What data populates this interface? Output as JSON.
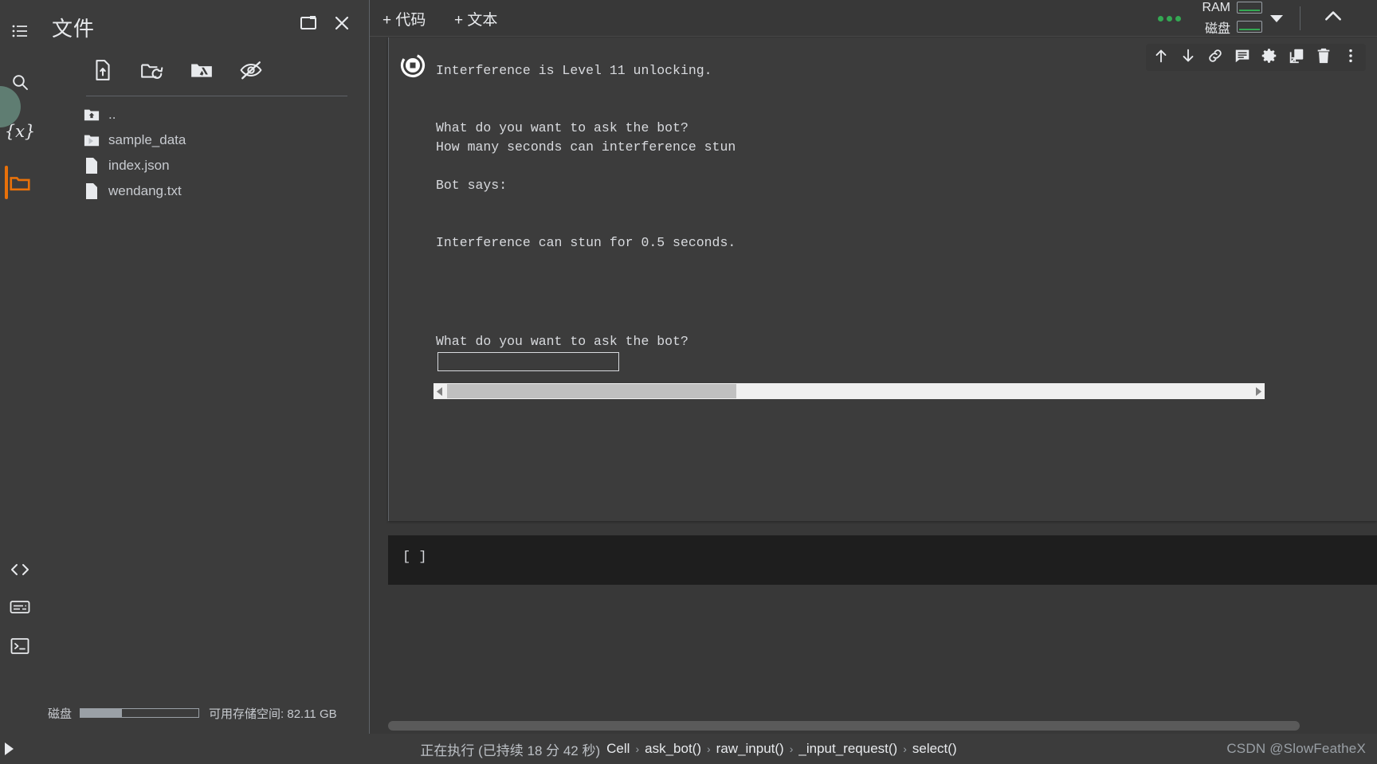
{
  "rail": {
    "items": [
      {
        "name": "table-of-contents",
        "icon": "list-icon"
      },
      {
        "name": "search",
        "icon": "search-icon"
      },
      {
        "name": "variables",
        "icon": "variables-icon"
      },
      {
        "name": "files",
        "icon": "folder-icon",
        "selected": true
      },
      {
        "name": "code-snippets",
        "icon": "code-brackets-icon"
      },
      {
        "name": "commands",
        "icon": "keyboard-icon"
      },
      {
        "name": "terminal",
        "icon": "terminal-icon"
      }
    ]
  },
  "files_panel": {
    "title": "文件",
    "header_buttons": [
      {
        "name": "open-in-new-pane",
        "icon": "window-icon"
      },
      {
        "name": "close-panel",
        "icon": "close-icon"
      }
    ],
    "toolbar": [
      {
        "name": "upload-file",
        "icon": "upload-file-icon"
      },
      {
        "name": "refresh-folder",
        "icon": "refresh-folder-icon"
      },
      {
        "name": "mount-drive",
        "icon": "google-drive-icon"
      },
      {
        "name": "toggle-hidden",
        "icon": "eye-off-icon"
      }
    ],
    "entries": [
      {
        "name": "..",
        "type": "parent"
      },
      {
        "name": "sample_data",
        "type": "folder",
        "expandable": true
      },
      {
        "name": "index.json",
        "type": "file"
      },
      {
        "name": "wendang.txt",
        "type": "file"
      }
    ],
    "footer": {
      "disk_label": "磁盘",
      "disk_used_percent": 35,
      "free_text": "可用存储空间: 82.11 GB"
    }
  },
  "notebook_toolbar": {
    "add_code": "+ 代码",
    "add_text": "+ 文本",
    "ram_label": "RAM",
    "disk_label": "磁盘",
    "status_color": "#34a853",
    "ram_gauge_percent": 20,
    "disk_gauge_percent": 20
  },
  "cell": {
    "run_state": "running",
    "actions": [
      {
        "name": "move-cell-up",
        "icon": "arrow-up-icon"
      },
      {
        "name": "move-cell-down",
        "icon": "arrow-down-icon"
      },
      {
        "name": "copy-cell-link",
        "icon": "link-icon"
      },
      {
        "name": "add-comment",
        "icon": "comment-icon"
      },
      {
        "name": "cell-settings",
        "icon": "gear-icon"
      },
      {
        "name": "mirror-cell",
        "icon": "mirror-cell-icon"
      },
      {
        "name": "delete-cell",
        "icon": "trash-icon"
      },
      {
        "name": "more-options",
        "icon": "more-vertical-icon"
      }
    ],
    "output_lines": [
      "Interference is Level 11 unlocking.",
      "",
      "",
      "What do you want to ask the bot?",
      "How many seconds can interference stun",
      "",
      "Bot says:",
      "",
      "",
      "Interference can stun for 0.5 seconds."
    ],
    "prompt_label": "What do you want to ask the bot?",
    "prompt_value": "",
    "prompt_placeholder": "",
    "output_scroll": {
      "thumb_percent": 36,
      "left_arrow": "scroll-left-arrow",
      "right_arrow": "scroll-right-arrow"
    }
  },
  "next_cell": {
    "index_label": "[ ]"
  },
  "status_bar": {
    "executing": "正在执行 (已持续 18 分 42 秒)",
    "crumbs": [
      "Cell",
      "ask_bot()",
      "raw_input()",
      "_input_request()",
      "select()"
    ],
    "separator": "›",
    "run_icon": "play-icon",
    "watermark": "CSDN @SlowFeatheX"
  }
}
